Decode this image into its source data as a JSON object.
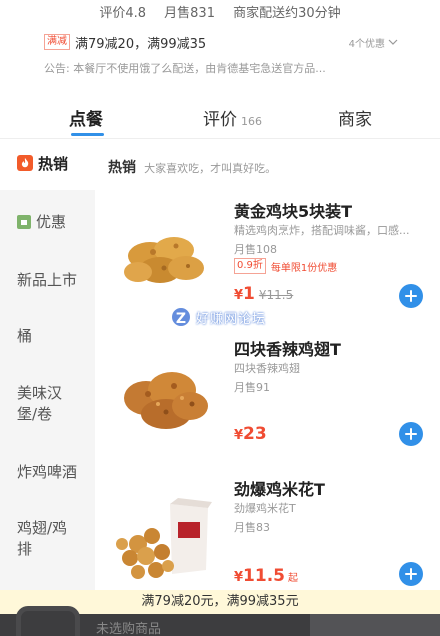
{
  "store": {
    "rating": "评价4.8",
    "monthly_sales": "月售831",
    "delivery": "商家配送约30分钟",
    "promo_tag": "满减",
    "promo_text": "满79减20，满99减35",
    "promo_more": "4个优惠",
    "notice": "公告: 本餐厅不使用饿了么配送，由肯德基宅急送官方品..."
  },
  "tabs": [
    {
      "label": "点餐"
    },
    {
      "label": "评价",
      "count": "166"
    },
    {
      "label": "商家"
    }
  ],
  "sidebar": {
    "items": [
      {
        "label": "热销"
      },
      {
        "label": "优惠"
      },
      {
        "label": "新品上市"
      },
      {
        "label": "桶"
      },
      {
        "label": "美味汉堡/卷"
      },
      {
        "label": "炸鸡啤酒"
      },
      {
        "label": "鸡翅/鸡排"
      }
    ]
  },
  "section": {
    "title": "热销",
    "subtitle": "大家喜欢吃，才叫真好吃。"
  },
  "items": [
    {
      "name": "黄金鸡块5块装T",
      "desc": "精选鸡肉烹炸，搭配调味酱，口感...",
      "sales": "月售108",
      "discount": "0.9折",
      "limit": "每单限1份优惠",
      "price": "1",
      "original_price": "¥11.5",
      "thumb_icon": "chicken-nuggets-photo"
    },
    {
      "name": "四块香辣鸡翅T",
      "desc": "四块香辣鸡翅",
      "sales": "月售91",
      "price": "23",
      "thumb_icon": "spicy-wings-photo"
    },
    {
      "name": "劲爆鸡米花T",
      "desc": "劲爆鸡米花T",
      "sales": "月售83",
      "price": "11.5",
      "price_suffix": "起",
      "thumb_icon": "popcorn-chicken-photo"
    }
  ],
  "currency": "¥",
  "watermark": {
    "logo": "Z",
    "text": "好赚网论坛"
  },
  "bottom": {
    "promo": "满79减20元，满99减35元",
    "cart_text": "未选购商品"
  },
  "colors": {
    "accent": "#3190e8",
    "price": "#f04c33",
    "cart_bar": "#3d3d3f",
    "promo_bar": "#fff8d9"
  }
}
